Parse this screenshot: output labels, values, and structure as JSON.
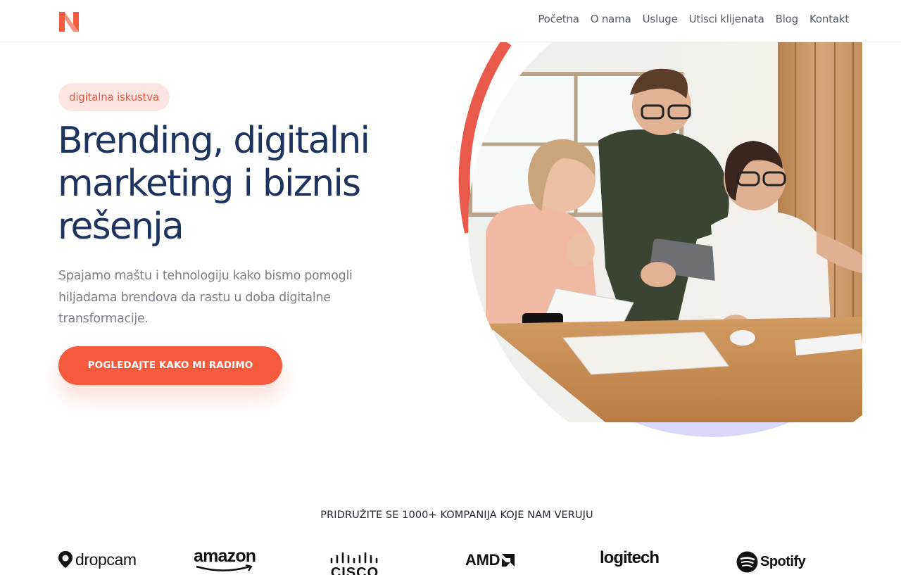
{
  "brand": {
    "logo_icon": "n-logo-icon",
    "accent": "#f65a3d"
  },
  "nav": {
    "items": [
      "Početna",
      "O nama",
      "Usluge",
      "Utisci klijenata",
      "Blog",
      "Kontakt"
    ]
  },
  "hero": {
    "badge": "digitalna iskustva",
    "title_line1": "Brending, digitalni",
    "title_line2": "marketing i biznis",
    "title_line3": "rešenja",
    "subtitle_line1": "Spajamo maštu i tehnologiju kako bismo pomogli",
    "subtitle_line2": "hiljadama brendova da rastu u doba digitalne",
    "subtitle_line3": "transformacije.",
    "cta_label": "POGLEDAJTE KAKO MI RADIMO",
    "image_icon": "team-photo-image"
  },
  "trusted": {
    "title": "PRIDRUŽITE SE 1000+ KOMPANIJA KOJE NAM VERUJU",
    "logos": [
      {
        "name": "dropcam",
        "text": "dropcam"
      },
      {
        "name": "amazon",
        "text": "amazon"
      },
      {
        "name": "cisco",
        "text": "CISCO"
      },
      {
        "name": "amd",
        "text": "AMD"
      },
      {
        "name": "logitech",
        "text": "logitech"
      },
      {
        "name": "spotify",
        "text": "Spotify"
      }
    ]
  },
  "colors": {
    "title": "#1d3461",
    "badge_bg": "#fde6e2",
    "badge_text": "#ec5a3e",
    "ring_left": "#ea5a4a",
    "ring_bottom": "#d8d7fb"
  }
}
